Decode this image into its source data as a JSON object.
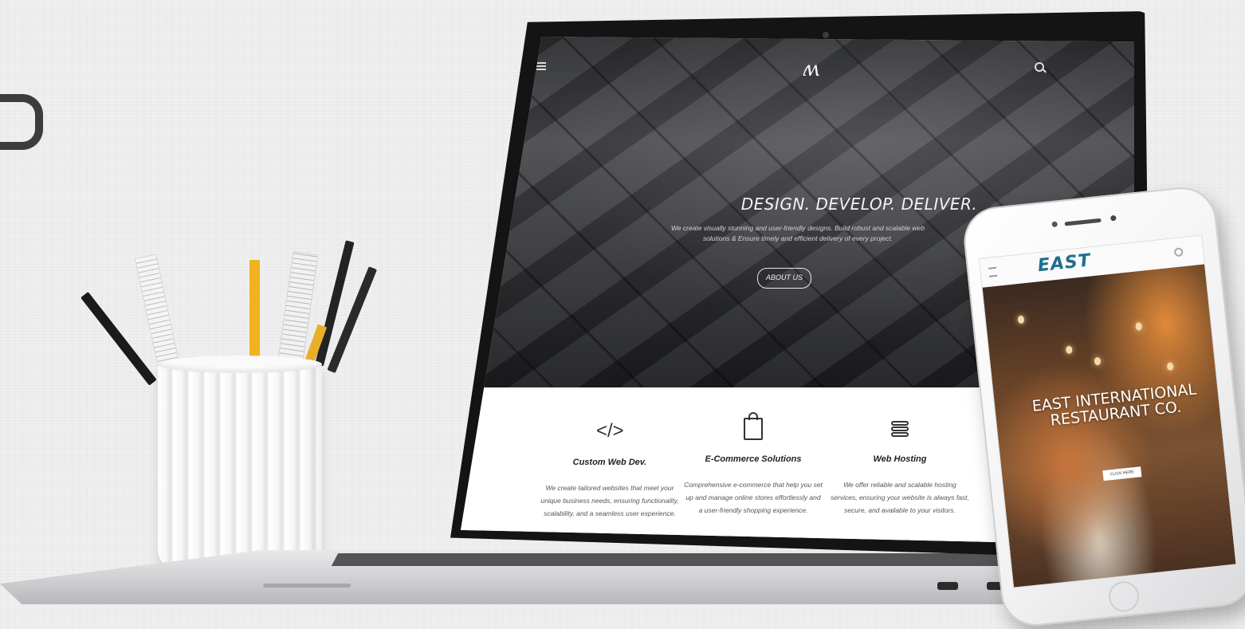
{
  "laptop_site": {
    "nav": {
      "logo": "ʍ",
      "menu_icon": "hamburger-icon",
      "search_icon": "search-icon"
    },
    "hero": {
      "title": "DESIGN. DEVELOP. DELIVER.",
      "subtitle": "We create visually stunning and user-friendly designs. Build robust and scalable web solutions & Ensure timely and efficient delivery of every project.",
      "button_label": "ABOUT US"
    },
    "services": [
      {
        "icon": "code-icon",
        "icon_glyph": "</>",
        "title": "Custom Web Dev.",
        "text": "We create tailored websites that meet your unique business needs, ensuring functionality, scalability, and a seamless user experience."
      },
      {
        "icon": "shopping-bag-icon",
        "title": "E-Commerce Solutions",
        "text": "Comprehensive e-commerce that help you set up and manage online stores effortlessly and a user-friendly shopping experience."
      },
      {
        "icon": "server-icon",
        "title": "Web Hosting",
        "text": "We offer reliable and scalable hosting services, ensuring your website is always fast, secure, and available to your visitors."
      }
    ]
  },
  "phone_site": {
    "logo": "EAST",
    "hero_title": "EAST INTERNATIONAL RESTAURANT CO.",
    "button_label": "CLICK HERE",
    "brand_color": "#1f6e8f"
  }
}
